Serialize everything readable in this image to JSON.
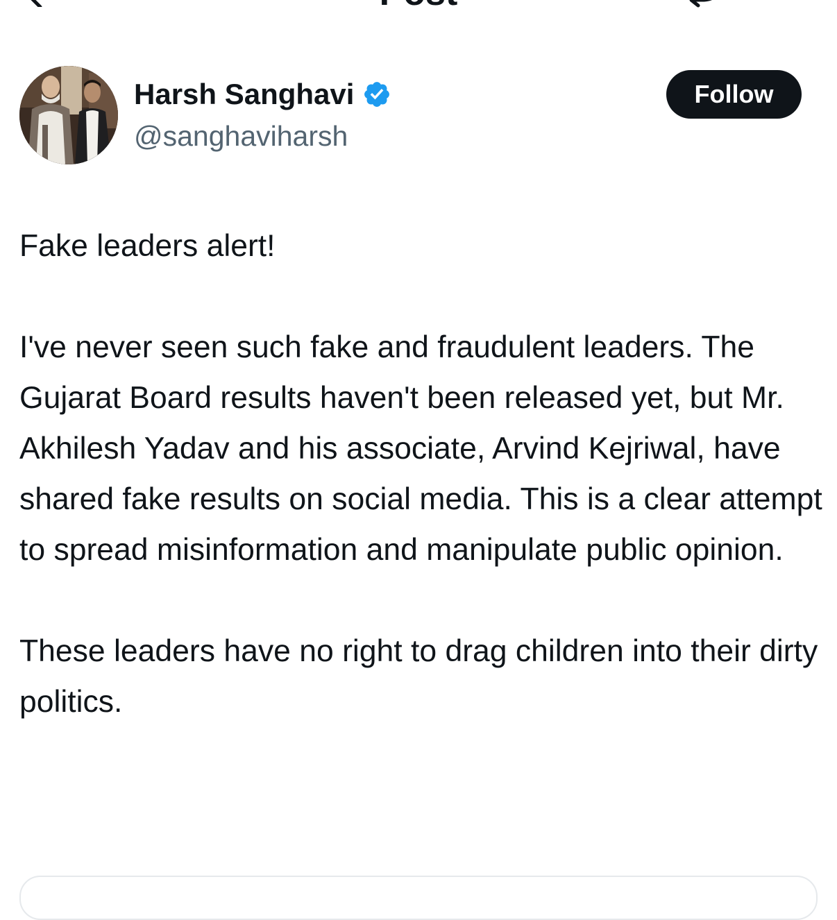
{
  "header": {
    "title": "Post",
    "back_icon": "back-arrow-icon",
    "right_icon": "reply-icon"
  },
  "author": {
    "name": "Harsh Sanghavi",
    "handle": "@sanghaviharsh",
    "verified": true,
    "verified_color": "#1d9bf0"
  },
  "follow_button": {
    "label": "Follow",
    "color": "#0f1419"
  },
  "post": {
    "paragraphs": [
      "Fake leaders alert!",
      "I've never seen such fake and fraudulent leaders. The Gujarat Board results haven't been released yet, but Mr. Akhilesh Yadav and his associate, Arvind Kejriwal, have shared fake results on social media. This is a clear attempt to spread misinformation and manipulate public opinion.",
      "These leaders have no right to drag children into their dirty politics."
    ]
  }
}
